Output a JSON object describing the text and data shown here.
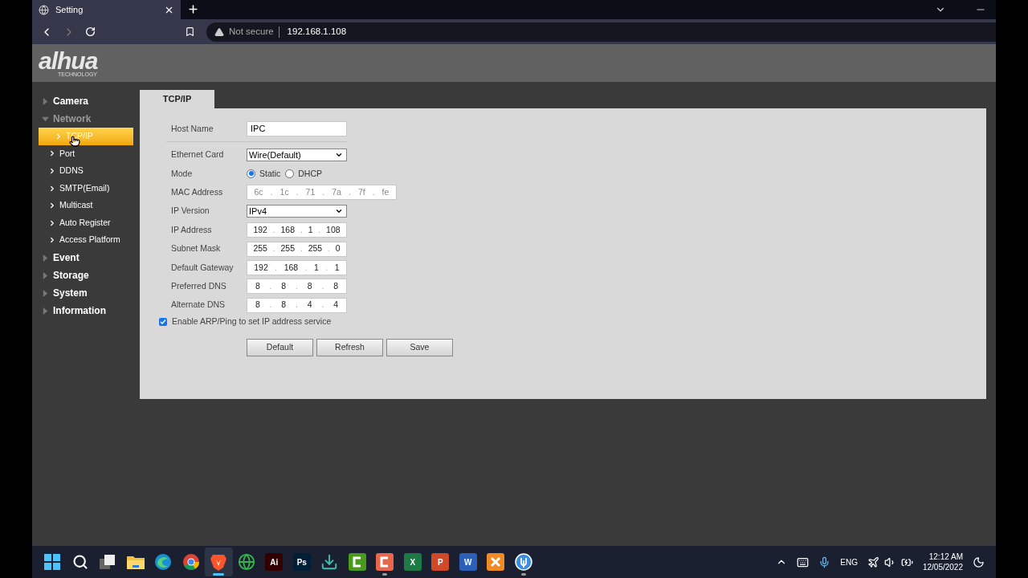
{
  "browser": {
    "tab_title": "Setting",
    "security": "Not secure",
    "url": "192.168.1.108"
  },
  "header": {
    "logo": "alhua",
    "logo_sub": "TECHNOLOGY"
  },
  "sidebar": {
    "items": [
      {
        "label": "Camera",
        "expanded": false
      },
      {
        "label": "Network",
        "expanded": true,
        "children": [
          {
            "label": "TCP/IP",
            "selected": true
          },
          {
            "label": "Port",
            "selected": false
          },
          {
            "label": "DDNS",
            "selected": false
          },
          {
            "label": "SMTP(Email)",
            "selected": false
          },
          {
            "label": "Multicast",
            "selected": false
          },
          {
            "label": "Auto Register",
            "selected": false
          },
          {
            "label": "Access Platform",
            "selected": false
          }
        ]
      },
      {
        "label": "Event",
        "expanded": false
      },
      {
        "label": "Storage",
        "expanded": false
      },
      {
        "label": "System",
        "expanded": false
      },
      {
        "label": "Information",
        "expanded": false
      }
    ]
  },
  "tabs": [
    {
      "label": "TCP/IP",
      "selected": true
    }
  ],
  "form": {
    "rows": [
      {
        "kind": "text",
        "label": "Host Name",
        "value": "IPC"
      },
      {
        "kind": "select",
        "label": "Ethernet Card",
        "value": "Wire(Default)"
      },
      {
        "kind": "radio",
        "label": "Mode",
        "options": [
          {
            "label": "Static",
            "selected": true
          },
          {
            "label": "DHCP",
            "selected": false
          }
        ]
      },
      {
        "kind": "octets",
        "label": "MAC Address",
        "disabled": true,
        "separator": ".",
        "values": [
          "6c",
          "1c",
          "71",
          "7a",
          "7f",
          "fe"
        ]
      },
      {
        "kind": "select",
        "label": "IP Version",
        "value": "IPv4"
      },
      {
        "kind": "octets",
        "label": "IP Address",
        "disabled": false,
        "separator": ".",
        "values": [
          "192",
          "168",
          "1",
          "108"
        ]
      },
      {
        "kind": "octets",
        "label": "Subnet Mask",
        "disabled": false,
        "separator": ".",
        "values": [
          "255",
          "255",
          "255",
          "0"
        ]
      },
      {
        "kind": "octets",
        "label": "Default Gateway",
        "disabled": false,
        "separator": ".",
        "values": [
          "192",
          "168",
          "1",
          "1"
        ]
      },
      {
        "kind": "octets",
        "label": "Preferred DNS",
        "disabled": false,
        "separator": ".",
        "values": [
          "8",
          "8",
          "8",
          "8"
        ]
      },
      {
        "kind": "octets",
        "label": "Alternate DNS",
        "disabled": false,
        "separator": ".",
        "values": [
          "8",
          "8",
          "4",
          "4"
        ]
      }
    ],
    "checkbox": {
      "label": "Enable ARP/Ping to set IP address service",
      "checked": true
    },
    "buttons": [
      "Default",
      "Refresh",
      "Save"
    ]
  },
  "taskbar": {
    "apps": [
      {
        "kind": "start",
        "selected": false,
        "running": false
      },
      {
        "kind": "search",
        "selected": false,
        "running": false
      },
      {
        "kind": "taskview",
        "selected": false,
        "running": false
      },
      {
        "kind": "folder",
        "selected": false,
        "running": false
      },
      {
        "kind": "edge",
        "selected": false,
        "running": false
      },
      {
        "kind": "chrome",
        "selected": false,
        "running": false
      },
      {
        "kind": "brave",
        "selected": true,
        "running": true
      },
      {
        "kind": "globe",
        "selected": false,
        "running": false
      },
      {
        "kind": "letter",
        "label": "Ai",
        "color": "#330000",
        "selected": false,
        "running": false
      },
      {
        "kind": "letter",
        "label": "Ps",
        "color": "#001e36",
        "selected": false,
        "running": false
      },
      {
        "kind": "install",
        "selected": false,
        "running": false
      },
      {
        "kind": "camtasia",
        "color": "#4a9a1c",
        "selected": false,
        "running": false
      },
      {
        "kind": "camtasia",
        "color": "#e8674a",
        "selected": false,
        "running": true
      },
      {
        "kind": "letter",
        "label": "X",
        "color": "#1d7a45",
        "selected": false,
        "running": false
      },
      {
        "kind": "letter",
        "label": "P",
        "color": "#d04a2a",
        "selected": false,
        "running": false
      },
      {
        "kind": "letter",
        "label": "W",
        "color": "#2b5fb8",
        "selected": false,
        "running": false
      },
      {
        "kind": "xampp",
        "color": "#f08a24",
        "selected": false,
        "running": false
      },
      {
        "kind": "circle",
        "color": "#3a8de0",
        "selected": false,
        "running": true
      }
    ],
    "language": "ENG",
    "time": "12:12 AM",
    "date": "12/05/2022"
  }
}
